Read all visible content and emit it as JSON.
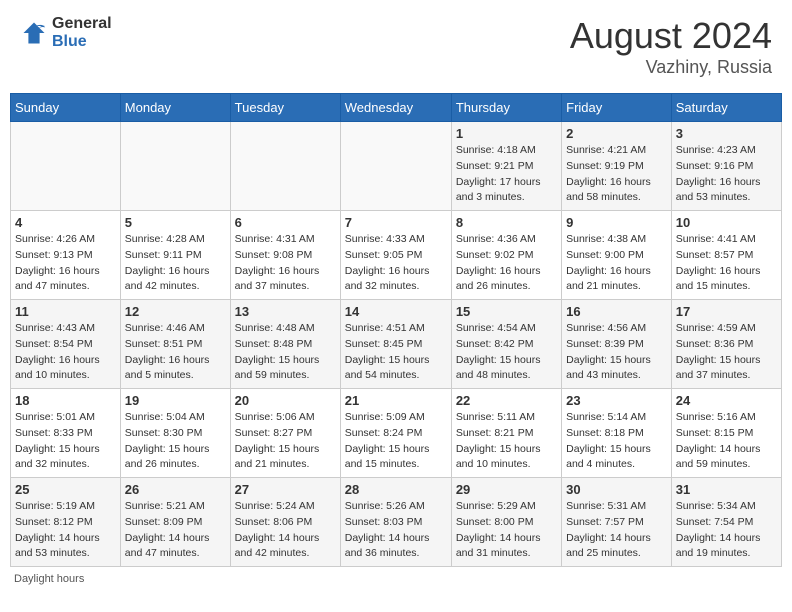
{
  "header": {
    "logo_general": "General",
    "logo_blue": "Blue",
    "month_year": "August 2024",
    "location": "Vazhiny, Russia"
  },
  "weekdays": [
    "Sunday",
    "Monday",
    "Tuesday",
    "Wednesday",
    "Thursday",
    "Friday",
    "Saturday"
  ],
  "weeks": [
    [
      {
        "day": "",
        "info": ""
      },
      {
        "day": "",
        "info": ""
      },
      {
        "day": "",
        "info": ""
      },
      {
        "day": "",
        "info": ""
      },
      {
        "day": "1",
        "info": "Sunrise: 4:18 AM\nSunset: 9:21 PM\nDaylight: 17 hours\nand 3 minutes."
      },
      {
        "day": "2",
        "info": "Sunrise: 4:21 AM\nSunset: 9:19 PM\nDaylight: 16 hours\nand 58 minutes."
      },
      {
        "day": "3",
        "info": "Sunrise: 4:23 AM\nSunset: 9:16 PM\nDaylight: 16 hours\nand 53 minutes."
      }
    ],
    [
      {
        "day": "4",
        "info": "Sunrise: 4:26 AM\nSunset: 9:13 PM\nDaylight: 16 hours\nand 47 minutes."
      },
      {
        "day": "5",
        "info": "Sunrise: 4:28 AM\nSunset: 9:11 PM\nDaylight: 16 hours\nand 42 minutes."
      },
      {
        "day": "6",
        "info": "Sunrise: 4:31 AM\nSunset: 9:08 PM\nDaylight: 16 hours\nand 37 minutes."
      },
      {
        "day": "7",
        "info": "Sunrise: 4:33 AM\nSunset: 9:05 PM\nDaylight: 16 hours\nand 32 minutes."
      },
      {
        "day": "8",
        "info": "Sunrise: 4:36 AM\nSunset: 9:02 PM\nDaylight: 16 hours\nand 26 minutes."
      },
      {
        "day": "9",
        "info": "Sunrise: 4:38 AM\nSunset: 9:00 PM\nDaylight: 16 hours\nand 21 minutes."
      },
      {
        "day": "10",
        "info": "Sunrise: 4:41 AM\nSunset: 8:57 PM\nDaylight: 16 hours\nand 15 minutes."
      }
    ],
    [
      {
        "day": "11",
        "info": "Sunrise: 4:43 AM\nSunset: 8:54 PM\nDaylight: 16 hours\nand 10 minutes."
      },
      {
        "day": "12",
        "info": "Sunrise: 4:46 AM\nSunset: 8:51 PM\nDaylight: 16 hours\nand 5 minutes."
      },
      {
        "day": "13",
        "info": "Sunrise: 4:48 AM\nSunset: 8:48 PM\nDaylight: 15 hours\nand 59 minutes."
      },
      {
        "day": "14",
        "info": "Sunrise: 4:51 AM\nSunset: 8:45 PM\nDaylight: 15 hours\nand 54 minutes."
      },
      {
        "day": "15",
        "info": "Sunrise: 4:54 AM\nSunset: 8:42 PM\nDaylight: 15 hours\nand 48 minutes."
      },
      {
        "day": "16",
        "info": "Sunrise: 4:56 AM\nSunset: 8:39 PM\nDaylight: 15 hours\nand 43 minutes."
      },
      {
        "day": "17",
        "info": "Sunrise: 4:59 AM\nSunset: 8:36 PM\nDaylight: 15 hours\nand 37 minutes."
      }
    ],
    [
      {
        "day": "18",
        "info": "Sunrise: 5:01 AM\nSunset: 8:33 PM\nDaylight: 15 hours\nand 32 minutes."
      },
      {
        "day": "19",
        "info": "Sunrise: 5:04 AM\nSunset: 8:30 PM\nDaylight: 15 hours\nand 26 minutes."
      },
      {
        "day": "20",
        "info": "Sunrise: 5:06 AM\nSunset: 8:27 PM\nDaylight: 15 hours\nand 21 minutes."
      },
      {
        "day": "21",
        "info": "Sunrise: 5:09 AM\nSunset: 8:24 PM\nDaylight: 15 hours\nand 15 minutes."
      },
      {
        "day": "22",
        "info": "Sunrise: 5:11 AM\nSunset: 8:21 PM\nDaylight: 15 hours\nand 10 minutes."
      },
      {
        "day": "23",
        "info": "Sunrise: 5:14 AM\nSunset: 8:18 PM\nDaylight: 15 hours\nand 4 minutes."
      },
      {
        "day": "24",
        "info": "Sunrise: 5:16 AM\nSunset: 8:15 PM\nDaylight: 14 hours\nand 59 minutes."
      }
    ],
    [
      {
        "day": "25",
        "info": "Sunrise: 5:19 AM\nSunset: 8:12 PM\nDaylight: 14 hours\nand 53 minutes."
      },
      {
        "day": "26",
        "info": "Sunrise: 5:21 AM\nSunset: 8:09 PM\nDaylight: 14 hours\nand 47 minutes."
      },
      {
        "day": "27",
        "info": "Sunrise: 5:24 AM\nSunset: 8:06 PM\nDaylight: 14 hours\nand 42 minutes."
      },
      {
        "day": "28",
        "info": "Sunrise: 5:26 AM\nSunset: 8:03 PM\nDaylight: 14 hours\nand 36 minutes."
      },
      {
        "day": "29",
        "info": "Sunrise: 5:29 AM\nSunset: 8:00 PM\nDaylight: 14 hours\nand 31 minutes."
      },
      {
        "day": "30",
        "info": "Sunrise: 5:31 AM\nSunset: 7:57 PM\nDaylight: 14 hours\nand 25 minutes."
      },
      {
        "day": "31",
        "info": "Sunrise: 5:34 AM\nSunset: 7:54 PM\nDaylight: 14 hours\nand 19 minutes."
      }
    ]
  ],
  "footer": {
    "daylight_label": "Daylight hours"
  }
}
